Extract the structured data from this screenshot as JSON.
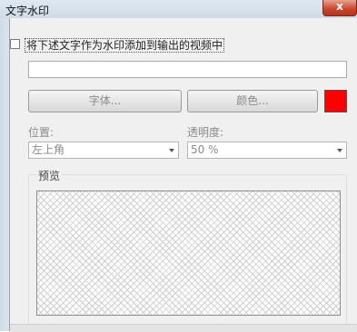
{
  "window": {
    "title": "文字水印",
    "close_glyph": "x"
  },
  "enable_watermark": {
    "checked": false,
    "label": "将下述文字作为水印添加到输出的视频中"
  },
  "watermark_text": {
    "value": ""
  },
  "buttons": {
    "font_label": "字体...",
    "color_label": "颜色..."
  },
  "color_swatch": {
    "color": "#ff0000"
  },
  "position": {
    "label": "位置:",
    "selected": "左上角"
  },
  "opacity": {
    "label": "透明度:",
    "selected": "50 %"
  },
  "preview": {
    "label": "预览"
  }
}
